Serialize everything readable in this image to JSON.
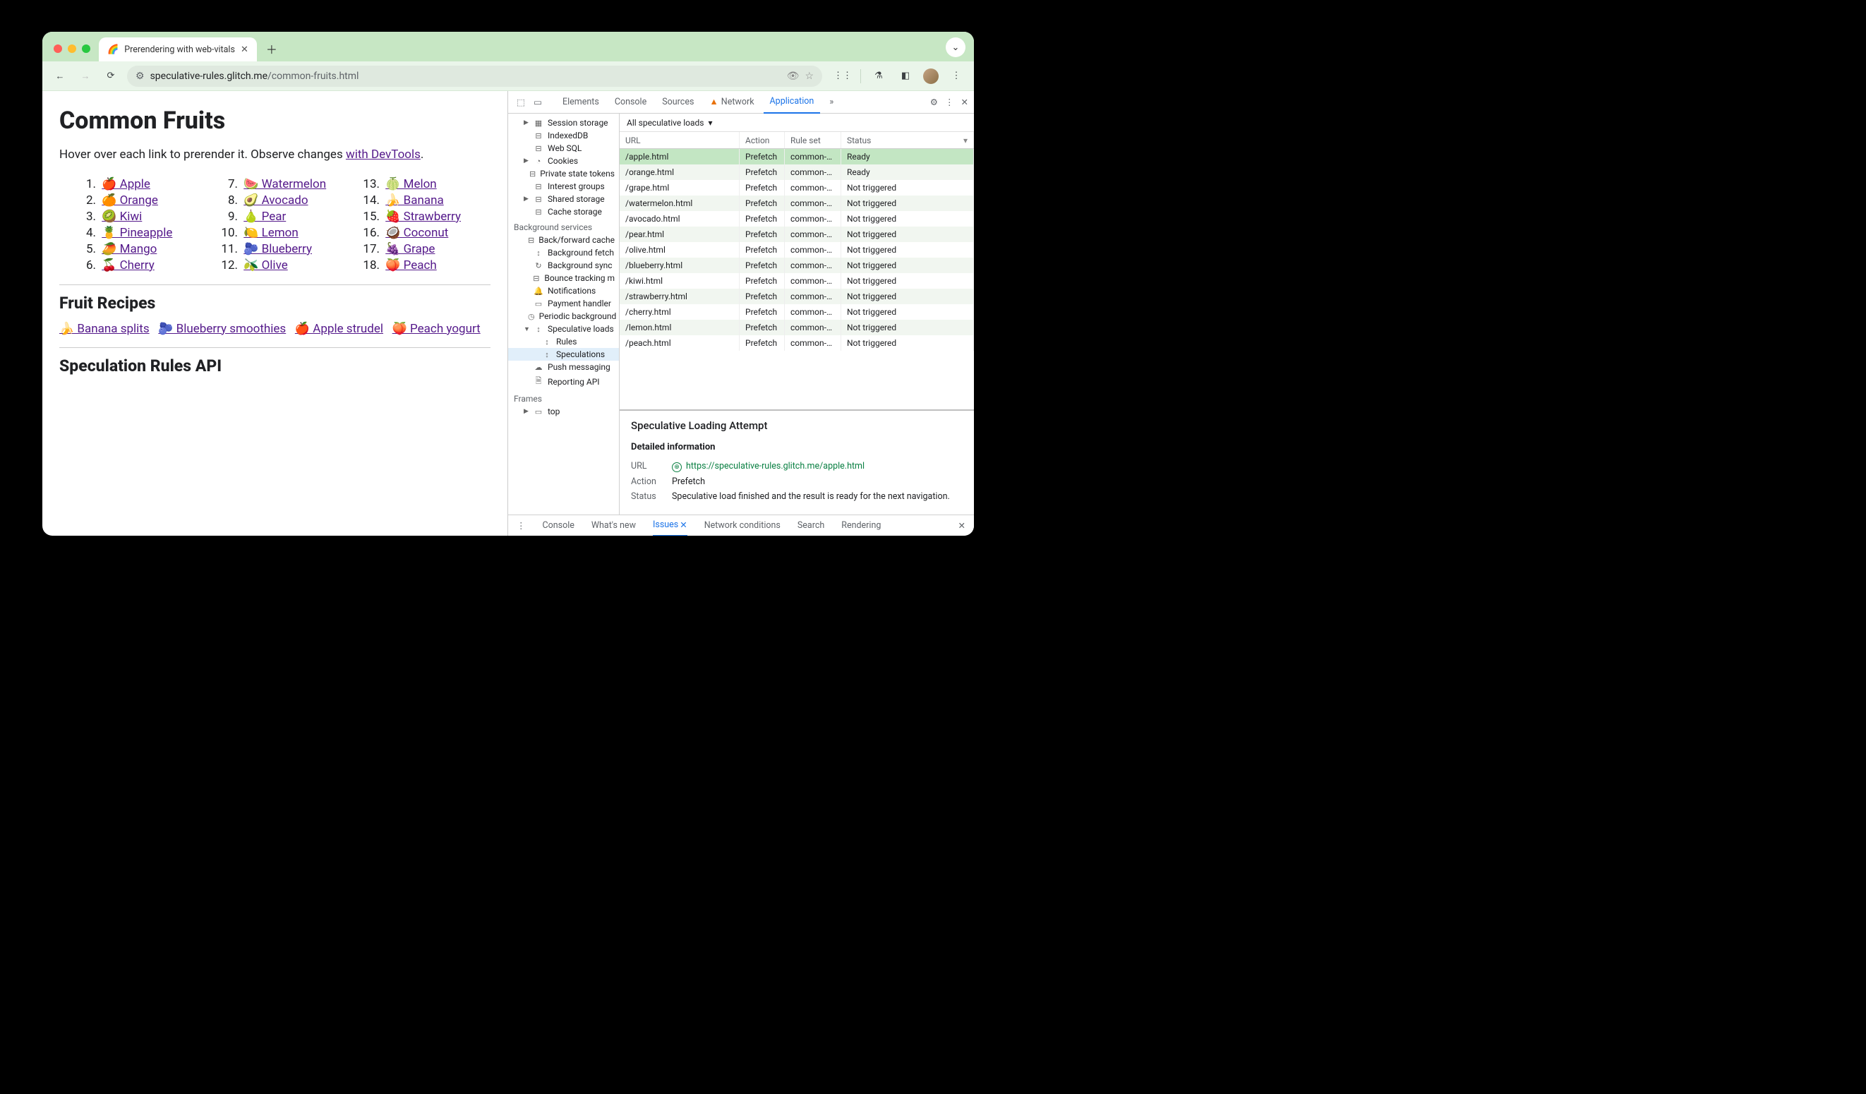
{
  "browser": {
    "tab_title": "Prerendering with web-vitals",
    "url_host": "speculative-rules.glitch.me",
    "url_path": "/common-fruits.html"
  },
  "page": {
    "h1": "Common Fruits",
    "intro_pre": "Hover over each link to prerender it. Observe changes ",
    "intro_link": "with DevTools",
    "intro_post": ".",
    "fruits": [
      {
        "n": "1.",
        "e": "🍎",
        "t": "Apple"
      },
      {
        "n": "2.",
        "e": "🍊",
        "t": "Orange"
      },
      {
        "n": "3.",
        "e": "🥝",
        "t": "Kiwi"
      },
      {
        "n": "4.",
        "e": "🍍",
        "t": "Pineapple"
      },
      {
        "n": "5.",
        "e": "🥭",
        "t": "Mango"
      },
      {
        "n": "6.",
        "e": "🍒",
        "t": "Cherry"
      },
      {
        "n": "7.",
        "e": "🍉",
        "t": "Watermelon"
      },
      {
        "n": "8.",
        "e": "🥑",
        "t": "Avocado"
      },
      {
        "n": "9.",
        "e": "🍐",
        "t": "Pear"
      },
      {
        "n": "10.",
        "e": "🍋",
        "t": "Lemon"
      },
      {
        "n": "11.",
        "e": "🫐",
        "t": "Blueberry"
      },
      {
        "n": "12.",
        "e": "🫒",
        "t": "Olive"
      },
      {
        "n": "13.",
        "e": "🍈",
        "t": "Melon"
      },
      {
        "n": "14.",
        "e": "🍌",
        "t": "Banana"
      },
      {
        "n": "15.",
        "e": "🍓",
        "t": "Strawberry"
      },
      {
        "n": "16.",
        "e": "🥥",
        "t": "Coconut"
      },
      {
        "n": "17.",
        "e": "🍇",
        "t": "Grape"
      },
      {
        "n": "18.",
        "e": "🍑",
        "t": "Peach"
      }
    ],
    "h2a": "Fruit Recipes",
    "recipes": [
      {
        "e": "🍌",
        "t": "Banana splits"
      },
      {
        "e": "🫐",
        "t": "Blueberry smoothies"
      },
      {
        "e": "🍎",
        "t": "Apple strudel"
      },
      {
        "e": "🍑",
        "t": "Peach yogurt"
      }
    ],
    "h2b": "Speculation Rules API"
  },
  "devtools": {
    "tabs": {
      "elements": "Elements",
      "console": "Console",
      "sources": "Sources",
      "network": "Network",
      "application": "Application"
    },
    "sidebar": {
      "storage_items": [
        "Session storage",
        "IndexedDB",
        "Web SQL",
        "Cookies",
        "Private state tokens",
        "Interest groups",
        "Shared storage",
        "Cache storage"
      ],
      "bg_head": "Background services",
      "bg_items": [
        "Back/forward cache",
        "Background fetch",
        "Background sync",
        "Bounce tracking m",
        "Notifications",
        "Payment handler",
        "Periodic background",
        "Speculative loads",
        "Rules",
        "Speculations",
        "Push messaging",
        "Reporting API"
      ],
      "frames_head": "Frames",
      "frames_top": "top"
    },
    "filter_label": "All speculative loads",
    "columns": {
      "url": "URL",
      "action": "Action",
      "ruleset": "Rule set",
      "status": "Status"
    },
    "rows": [
      {
        "url": "/apple.html",
        "action": "Prefetch",
        "rs": "common-…",
        "status": "Ready",
        "sel": true
      },
      {
        "url": "/orange.html",
        "action": "Prefetch",
        "rs": "common-…",
        "status": "Ready"
      },
      {
        "url": "/grape.html",
        "action": "Prefetch",
        "rs": "common-…",
        "status": "Not triggered"
      },
      {
        "url": "/watermelon.html",
        "action": "Prefetch",
        "rs": "common-…",
        "status": "Not triggered"
      },
      {
        "url": "/avocado.html",
        "action": "Prefetch",
        "rs": "common-…",
        "status": "Not triggered"
      },
      {
        "url": "/pear.html",
        "action": "Prefetch",
        "rs": "common-…",
        "status": "Not triggered"
      },
      {
        "url": "/olive.html",
        "action": "Prefetch",
        "rs": "common-…",
        "status": "Not triggered"
      },
      {
        "url": "/blueberry.html",
        "action": "Prefetch",
        "rs": "common-…",
        "status": "Not triggered"
      },
      {
        "url": "/kiwi.html",
        "action": "Prefetch",
        "rs": "common-…",
        "status": "Not triggered"
      },
      {
        "url": "/strawberry.html",
        "action": "Prefetch",
        "rs": "common-…",
        "status": "Not triggered"
      },
      {
        "url": "/cherry.html",
        "action": "Prefetch",
        "rs": "common-…",
        "status": "Not triggered"
      },
      {
        "url": "/lemon.html",
        "action": "Prefetch",
        "rs": "common-…",
        "status": "Not triggered"
      },
      {
        "url": "/peach.html",
        "action": "Prefetch",
        "rs": "common-…",
        "status": "Not triggered"
      }
    ],
    "detail": {
      "title": "Speculative Loading Attempt",
      "sub": "Detailed information",
      "url_k": "URL",
      "url_v": "https://speculative-rules.glitch.me/apple.html",
      "action_k": "Action",
      "action_v": "Prefetch",
      "status_k": "Status",
      "status_v": "Speculative load finished and the result is ready for the next navigation."
    },
    "drawer": {
      "console": "Console",
      "whatsnew": "What's new",
      "issues": "Issues",
      "netcond": "Network conditions",
      "search": "Search",
      "rendering": "Rendering"
    }
  }
}
